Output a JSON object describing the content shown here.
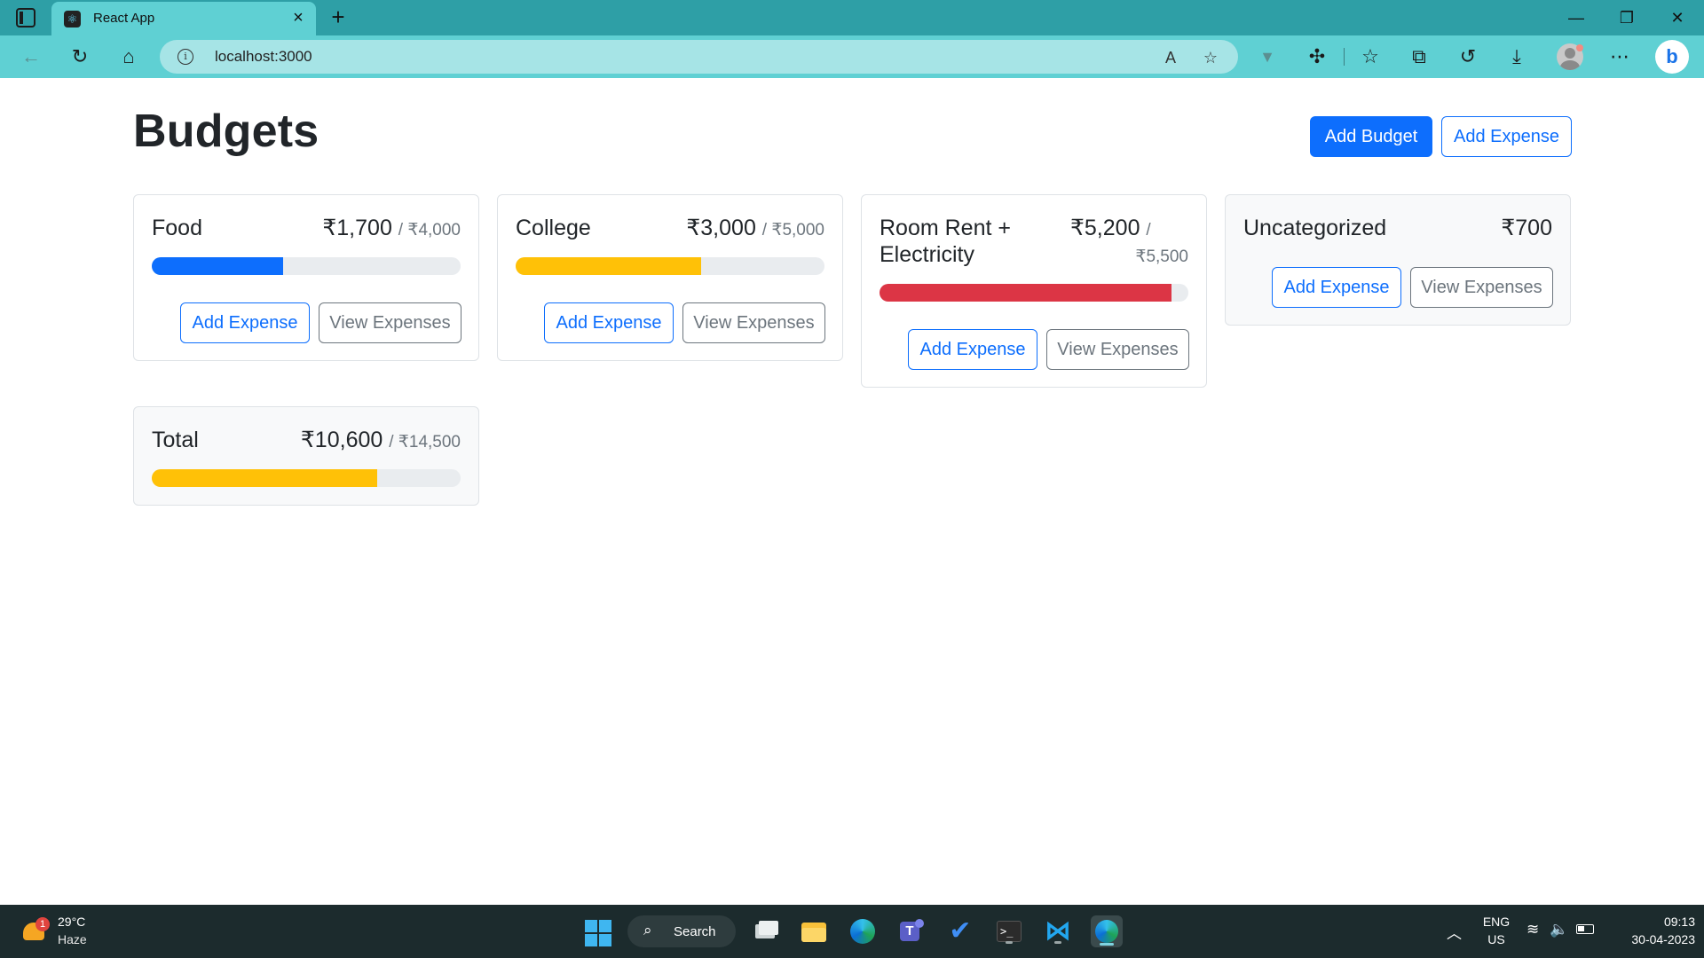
{
  "browser": {
    "tab_title": "React App",
    "url": "localhost:3000"
  },
  "page": {
    "title": "Budgets",
    "add_budget_label": "Add Budget",
    "add_expense_label": "Add Expense"
  },
  "budgets": [
    {
      "name": "Food",
      "amount": "₹1,700",
      "max": "/ ₹4,000",
      "progress": 0.425,
      "bar_color": "#0d6efd",
      "add_label": "Add Expense",
      "view_label": "View Expenses"
    },
    {
      "name": "College",
      "amount": "₹3,000",
      "max": "/ ₹5,000",
      "progress": 0.6,
      "bar_color": "#ffc107",
      "add_label": "Add Expense",
      "view_label": "View Expenses"
    },
    {
      "name_line1": "Room Rent +",
      "name_line2": "Electricity",
      "amount": "₹5,200",
      "max_slash": "/",
      "max_value": "₹5,500",
      "progress": 0.945,
      "bar_color": "#dc3545",
      "add_label": "Add Expense",
      "view_label": "View Expenses"
    },
    {
      "name": "Uncategorized",
      "amount": "₹700",
      "add_label": "Add Expense",
      "view_label": "View Expenses"
    }
  ],
  "total": {
    "name": "Total",
    "amount": "₹10,600",
    "max": "/ ₹14,500",
    "progress": 0.731,
    "bar_color": "#ffc107"
  },
  "taskbar": {
    "weather_badge": "1",
    "temperature": "29°C",
    "condition": "Haze",
    "search_label": "Search",
    "lang_line1": "ENG",
    "lang_line2": "US",
    "time": "09:13",
    "date": "30-04-2023"
  }
}
